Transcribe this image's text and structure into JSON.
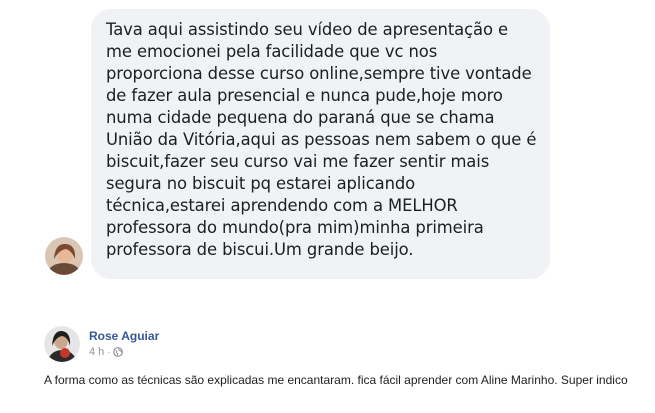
{
  "message": {
    "text": "Tava aqui assistindo seu vídeo de apresentação e me emocionei pela facilidade que vc nos proporciona desse curso online,sempre tive vontade de fazer aula presencial e nunca pude,hoje moro numa cidade pequena do paraná que se chama União da Vitória,aqui as pessoas nem sabem o que é biscuit,fazer seu curso vai me fazer sentir mais segura no biscuit pq estarei aplicando técnica,estarei aprendendo com a MELHOR professora do mundo(pra mim)minha primeira professora de biscui.Um grande beijo.",
    "bubble_color": "#f0f2f5"
  },
  "comment": {
    "author": "Rose Aguiar",
    "time": "4 h",
    "separator": "·",
    "privacy_icon": "globe-icon",
    "text": "A forma como as técnicas são explicadas me encantaram. fica fácil aprender com Aline Marinho. Super indico",
    "author_color": "#365899",
    "meta_color": "#90949c"
  }
}
